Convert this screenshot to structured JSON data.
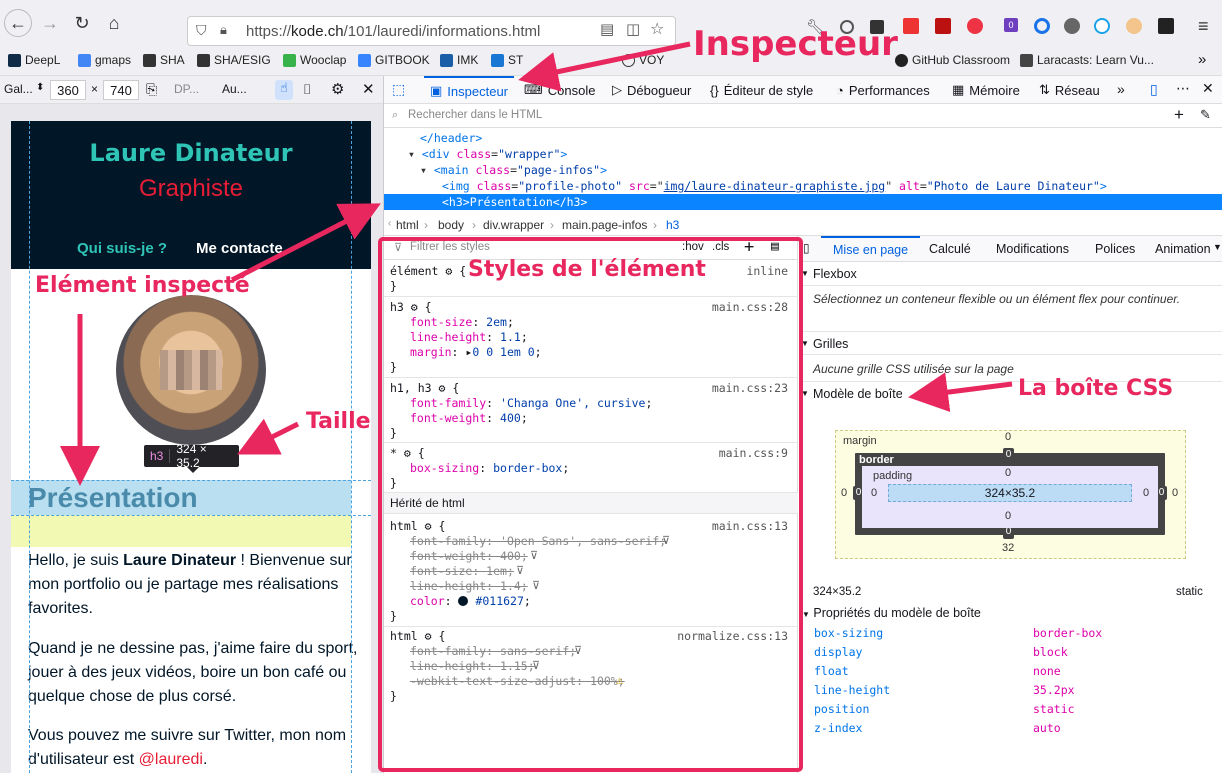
{
  "browser": {
    "url_prefix": "https://",
    "url_domain": "kode.ch",
    "url_path": "/101/lauredi/informations.html",
    "ext_badge": "0",
    "bookmarks": [
      "DeepL",
      "gmaps",
      "SHA",
      "SHA/ESIG",
      "Wooclap",
      "GITBOOK",
      "IMK",
      "ST",
      "VOY",
      "GitHub Classroom",
      "Laracasts: Learn Vu..."
    ]
  },
  "rdm": {
    "device": "Gal...",
    "width": "360",
    "times": "×",
    "height": "740",
    "dpr": "DP...",
    "throttle": "Au..."
  },
  "site": {
    "name": "Laure Dinateur",
    "role": "Graphiste",
    "nav": [
      "Qui suis-je ?",
      "Me contacte"
    ],
    "heading": "Présentation",
    "p1_a": "Hello, je suis ",
    "p1_b": "Laure Dinateur",
    "p1_c": " ! Bienvenue sur mon portfolio ou je partage mes réalisations favorites.",
    "p2": "Quand je ne dessine pas, j'aime faire du sport, jouer à des jeux vidéos, boire un bon café ou quelque chose de plus corsé.",
    "p3_a": "Vous pouvez me suivre sur Twitter, mon nom d'utilisateur est ",
    "p3_link": "@lauredi",
    "p3_end": "."
  },
  "tooltip": {
    "tag": "h3",
    "size": "324 × 35.2"
  },
  "devtools": {
    "tabs": [
      "Inspecteur",
      "Console",
      "Débogueur",
      "Éditeur de style",
      "Performances",
      "Mémoire",
      "Réseau"
    ],
    "search_placeholder": "Rechercher dans le HTML",
    "tree": {
      "l1": "</header>",
      "l2_tag": "div",
      "l2_attr": "class",
      "l2_val": "\"wrapper\"",
      "l3_tag": "main",
      "l3_attr": "class",
      "l3_val": "\"page-infos\"",
      "l4_src": "img/laure-dinateur-graphiste.jpg",
      "l4_class": "\"profile-photo\"",
      "l4_alt": "\"Photo de Laure Dinateur\"",
      "l5": "<h3>Présentation</h3>"
    },
    "breadcrumbs": [
      "html",
      "body",
      "div.wrapper",
      "main.page-infos",
      "h3"
    ],
    "rules": {
      "filter_placeholder": "Filtrer les styles",
      "hov": ":hov",
      "cls": ".cls",
      "element_sel": "élément",
      "element_src": "inline",
      "h3_src": "main.css:28",
      "h3_props": [
        [
          "font-size",
          "2em"
        ],
        [
          "line-height",
          "1.1"
        ],
        [
          "margin",
          "0 0 1em 0"
        ]
      ],
      "h1h3_src": "main.css:23",
      "h1h3_sel": "h1, h3",
      "h1h3_props": [
        [
          "font-family",
          "'Changa One', cursive"
        ],
        [
          "font-weight",
          "400"
        ]
      ],
      "star_src": "main.css:9",
      "star_props": [
        [
          "box-sizing",
          "border-box"
        ]
      ],
      "inherited": "Hérité de html",
      "html1_src": "main.css:13",
      "html1_props": [
        [
          "font-family",
          "'Open Sans', sans-serif"
        ],
        [
          "font-weight",
          "400"
        ],
        [
          "font-size",
          "1em"
        ],
        [
          "line-height",
          "1.4"
        ],
        [
          "color",
          "#011627"
        ]
      ],
      "html2_src": "normalize.css:13",
      "html2_props": [
        [
          "font-family",
          "sans-serif"
        ],
        [
          "line-height",
          "1.15"
        ],
        [
          "-webkit-text-size-adjust",
          "100%"
        ]
      ]
    },
    "layout": {
      "tabs": [
        "Mise en page",
        "Calculé",
        "Modifications",
        "Polices",
        "Animation"
      ],
      "flexbox": "Flexbox",
      "flexbox_msg": "Sélectionnez un conteneur flexible ou un élément flex pour continuer.",
      "grilles": "Grilles",
      "grilles_msg": "Aucune grille CSS utilisée sur la page",
      "boxmodel": "Modèle de boîte",
      "margin_label": "margin",
      "border_label": "border",
      "padding_label": "padding",
      "margin_top": "0",
      "margin_right": "0",
      "margin_bottom": "32",
      "margin_left": "0",
      "border_top": "0",
      "border_right": "0",
      "border_bottom": "0",
      "border_left": "0",
      "padding_top": "0",
      "padding_right": "0",
      "padding_bottom": "0",
      "padding_left": "0",
      "content": "324×35.2",
      "dims": "324×35.2",
      "position": "static",
      "props_title": "Propriétés du modèle de boîte",
      "props": [
        [
          "box-sizing",
          "border-box"
        ],
        [
          "display",
          "block"
        ],
        [
          "float",
          "none"
        ],
        [
          "line-height",
          "35.2px"
        ],
        [
          "position",
          "static"
        ],
        [
          "z-index",
          "auto"
        ]
      ]
    }
  },
  "annotations": {
    "inspecteur": "Inspecteur",
    "element": "Elément inspecté",
    "styles": "Styles de l'élément",
    "taille": "Taille",
    "boite": "La boîte CSS"
  },
  "colors": {
    "accent": "#e8275f",
    "selection": "#0a84ff",
    "site_bg": "#011627"
  }
}
